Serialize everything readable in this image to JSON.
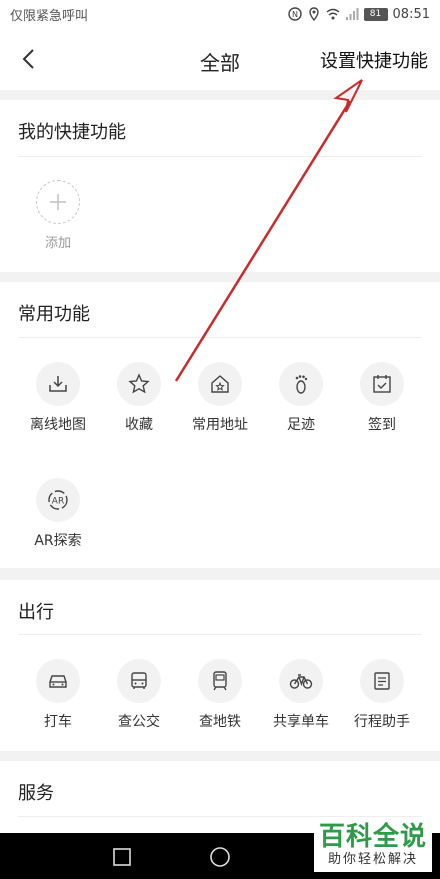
{
  "status_bar": {
    "carrier_text": "仅限紧急呼叫",
    "battery": "81",
    "time": "08:51"
  },
  "header": {
    "title": "全部",
    "action": "设置快捷功能"
  },
  "my_shortcuts": {
    "title": "我的快捷功能",
    "add_label": "添加"
  },
  "common": {
    "title": "常用功能",
    "items": [
      {
        "label": "离线地图",
        "icon": "offline-map-icon"
      },
      {
        "label": "收藏",
        "icon": "star-icon"
      },
      {
        "label": "常用地址",
        "icon": "home-star-icon"
      },
      {
        "label": "足迹",
        "icon": "footprint-icon"
      },
      {
        "label": "签到",
        "icon": "checkin-icon"
      },
      {
        "label": "AR探索",
        "icon": "ar-icon"
      }
    ]
  },
  "travel": {
    "title": "出行",
    "items": [
      {
        "label": "打车",
        "icon": "taxi-icon"
      },
      {
        "label": "查公交",
        "icon": "bus-icon"
      },
      {
        "label": "查地铁",
        "icon": "subway-icon"
      },
      {
        "label": "共享单车",
        "icon": "bike-icon"
      },
      {
        "label": "行程助手",
        "icon": "itinerary-icon"
      }
    ]
  },
  "services": {
    "title": "服务"
  },
  "watermark": {
    "main": "百科全说",
    "sub": "助你轻松解决"
  },
  "colors": {
    "annotation_arrow": "#cc2a2a",
    "watermark_green": "#2e9b4a"
  }
}
